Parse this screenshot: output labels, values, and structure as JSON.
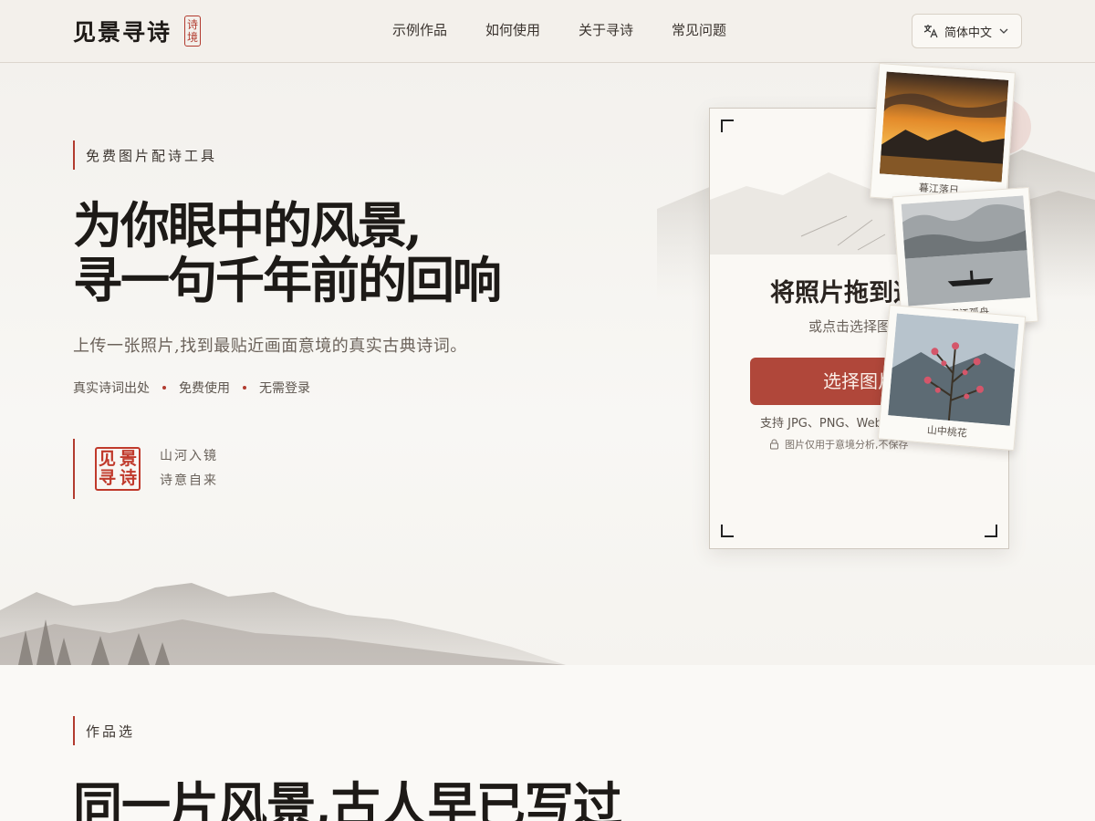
{
  "nav": {
    "brand": "见景寻诗",
    "seal_top": "诗",
    "seal_bottom": "境",
    "links": [
      "示例作品",
      "如何使用",
      "关于寻诗",
      "常见问题"
    ],
    "language": "简体中文"
  },
  "hero": {
    "tag": "免费图片配诗工具",
    "headline_line1": "为你眼中的风景,",
    "headline_line2": "寻一句千年前的回响",
    "subhead": "上传一张照片,找到最贴近画面意境的真实古典诗词。",
    "features": [
      "真实诗词出处",
      "免费使用",
      "无需登录"
    ],
    "motto_seal": [
      "见",
      "景",
      "寻",
      "诗"
    ],
    "motto_line1": "山河入镜",
    "motto_line2": "诗意自来"
  },
  "upload": {
    "title": "将照片拖到这",
    "subtitle": "或点击选择图",
    "button": "选择图片",
    "formats": "支持 JPG、PNG、WebP",
    "privacy": "图片仅用于意境分析,不保存"
  },
  "samples": [
    {
      "caption": "暮江落日",
      "icon": "sunset-photo"
    },
    {
      "caption": "寒江孤舟",
      "icon": "boat-on-river-photo"
    },
    {
      "caption": "山中桃花",
      "icon": "peach-blossom-photo"
    }
  ],
  "section2": {
    "tag": "作品选",
    "title": "同一片风景,古人早已写过"
  },
  "colors": {
    "accent": "#b23b2f",
    "button": "#b0473a",
    "background": "#f7f5f1"
  }
}
